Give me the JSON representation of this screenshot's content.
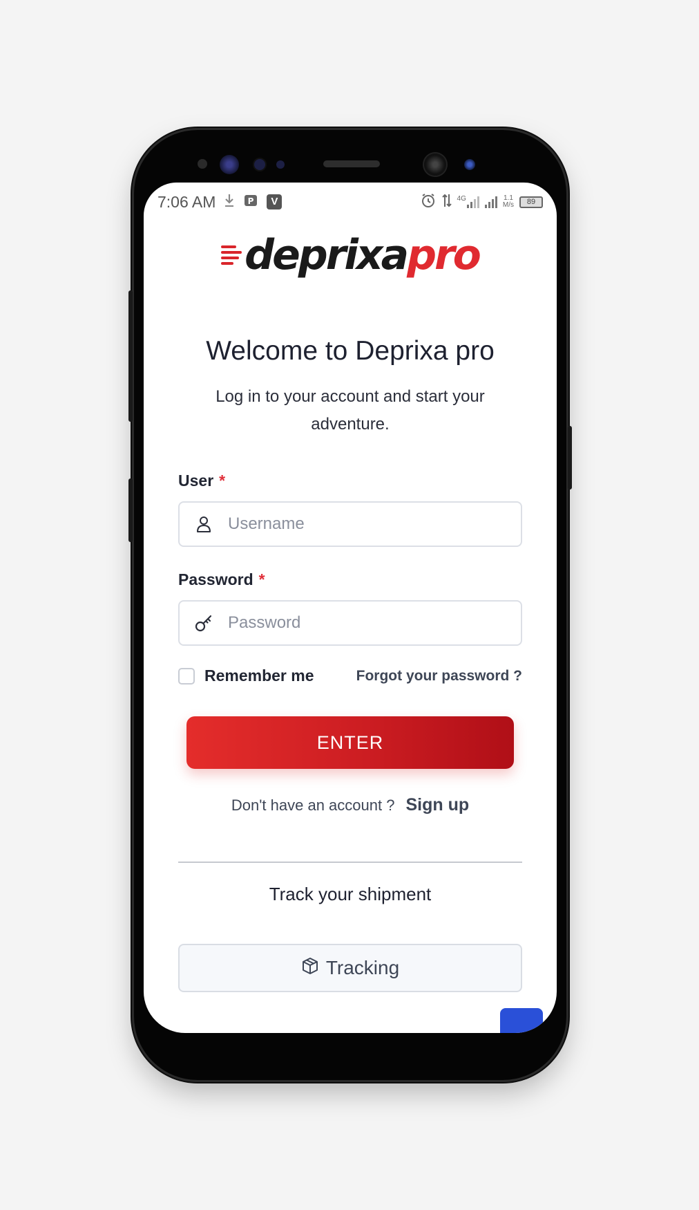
{
  "status_bar": {
    "time": "7:06 AM",
    "app_badge": "V",
    "network": "4G",
    "speed_value": "1.1",
    "speed_unit": "M/s",
    "battery": "89"
  },
  "logo": {
    "part_dark": "deprixa",
    "part_red": "pro"
  },
  "login": {
    "title": "Welcome to Deprixa pro",
    "subtitle": "Log in to your account and start your adventure.",
    "user_label": "User",
    "required_mark": "*",
    "username_placeholder": "Username",
    "password_label": "Password",
    "password_placeholder": "Password",
    "remember_label": "Remember me",
    "forgot_link": "Forgot your password ?",
    "enter_button": "ENTER",
    "no_account_text": "Don't have an account ?",
    "signup_link": "Sign up"
  },
  "tracking": {
    "title": "Track your shipment",
    "button_label": "Tracking"
  },
  "colors": {
    "accent_red": "#e02a30",
    "button_gradient_end": "#b00f17",
    "text_dark": "#1e2130",
    "floating_button": "#2a50d8"
  },
  "icons": {
    "user_field": "user-icon",
    "password_field": "key-icon",
    "tracking": "package-icon"
  }
}
